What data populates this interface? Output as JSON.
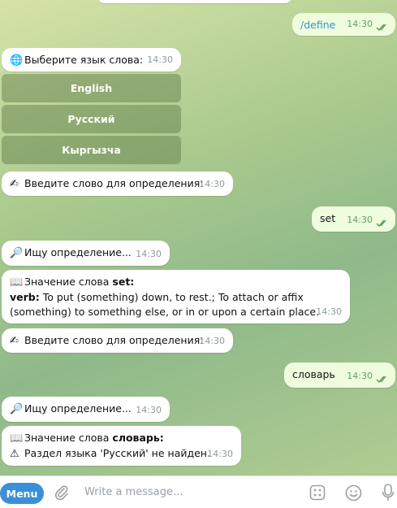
{
  "messages": {
    "m1_text": "/define",
    "m1_time": "14:30",
    "m2_text": "Выберите язык слова:",
    "m2_time": "14:30",
    "m3_text": "Введите слово для определения:",
    "m3_time": "14:30",
    "m4_text": "set",
    "m4_time": "14:30",
    "m5_text": "Ищу определение...",
    "m5_time": "14:30",
    "m6_line1_prefix": "Значение слова ",
    "m6_word": "set:",
    "m6_pos": "verb:",
    "m6_def1": " To put (something) down, to rest.; To attach or affix",
    "m6_def2": "(something) to something else, or in or upon a certain place.",
    "m6_time": "14:30",
    "m7_text": "Введите слово для определения:",
    "m7_time": "14:30",
    "m8_text": "словарь",
    "m8_time": "14:30",
    "m9_text": "Ищу определение...",
    "m9_time": "14:30",
    "m10_line1_prefix": "Значение слова ",
    "m10_word": "словарь:",
    "m10_line2": "Раздел языка 'Русский' не найден.",
    "m10_time": "14:30"
  },
  "keyboard": [
    "English",
    "Русский",
    "Кыргызча"
  ],
  "input": {
    "menu_label": "Menu",
    "placeholder": "Write a message..."
  },
  "icons": {
    "globe": "globe-icon",
    "writing_hand": "writing-hand-icon",
    "magnifier": "magnifier-icon",
    "book": "book-icon",
    "warning": "warning-icon",
    "attach": "paperclip-icon",
    "bot_commands": "bot-commands-icon",
    "emoji": "emoji-icon",
    "mic": "microphone-icon",
    "read": "double-check-icon"
  },
  "colors": {
    "accent": "#3a90d8",
    "outgoing_bubble": "#effdde",
    "incoming_bubble": "#ffffff",
    "check": "#5fa05f"
  }
}
